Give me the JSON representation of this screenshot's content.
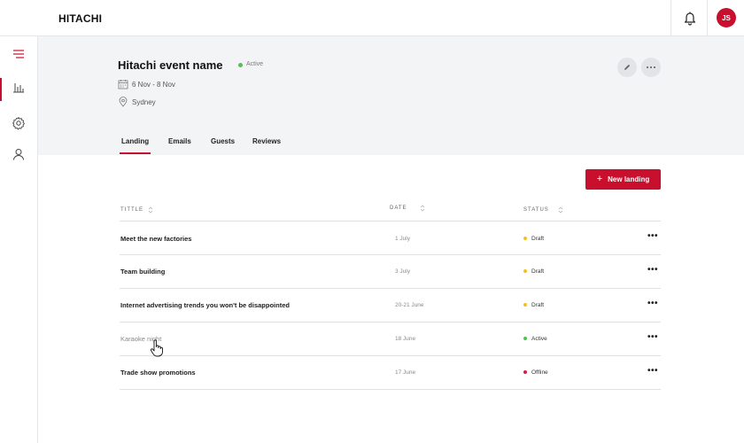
{
  "app": {
    "logo": "HITACHI"
  },
  "topbar": {
    "avatar_initials": "JS"
  },
  "event": {
    "title": "Hitachi event name",
    "status": "Active",
    "dates": "6 Nov - 8 Nov",
    "location": "Sydney"
  },
  "tabs": [
    {
      "label": "Landing",
      "active": true
    },
    {
      "label": "Emails",
      "active": false
    },
    {
      "label": "Guests",
      "active": false
    },
    {
      "label": "Reviews",
      "active": false
    }
  ],
  "actions": {
    "new_landing": "New landing",
    "new_landing_icon": "+"
  },
  "table": {
    "columns": [
      "TITTLE",
      "DATE",
      "STATUS"
    ],
    "row_menu": "•••",
    "rows": [
      {
        "title": "Meet the new factories",
        "date": "1 July",
        "status": "Draft",
        "status_color": "#f2c21b"
      },
      {
        "title": "Team building",
        "date": "3 July",
        "status": "Draft",
        "status_color": "#f2c21b"
      },
      {
        "title": "Internet advertising trends you won't be disappointed",
        "date": "20-21 June",
        "status": "Draft",
        "status_color": "#f2c21b"
      },
      {
        "title": "Karaoke night",
        "date": "18 June",
        "status": "Active",
        "status_color": "#4fc24f"
      },
      {
        "title": "Trade show promotions",
        "date": "17 June",
        "status": "Offline",
        "status_color": "#d81b4a"
      }
    ]
  },
  "colors": {
    "accent": "#c8102e",
    "band": "#f3f4f6"
  }
}
